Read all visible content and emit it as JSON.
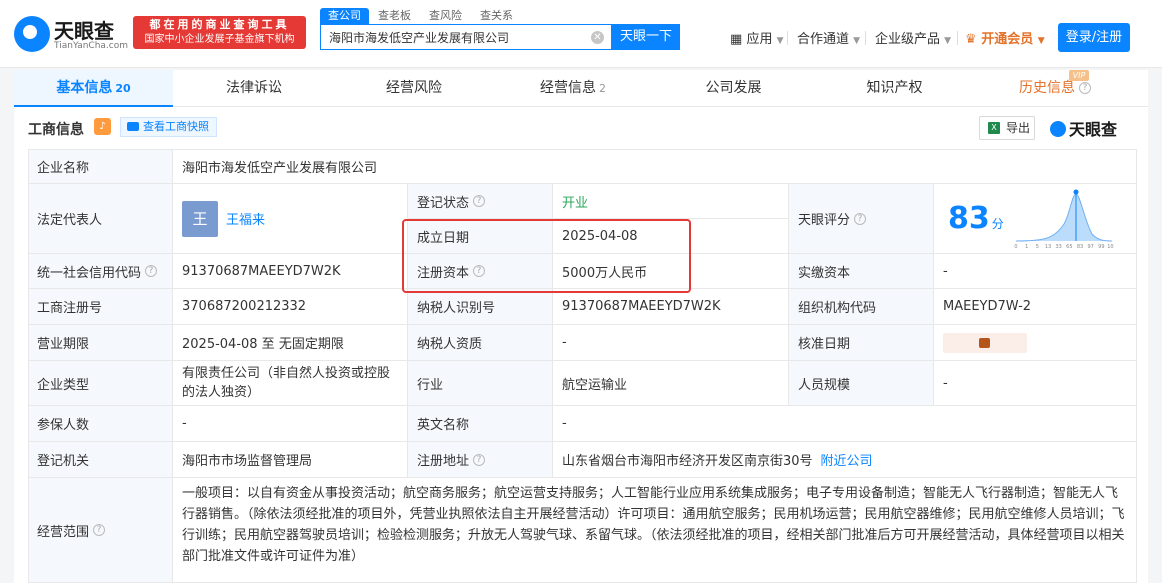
{
  "header": {
    "logo_name": "天眼查",
    "logo_sub": "TianYanCha.com",
    "banner_line1": "都在用的商业查询工具",
    "banner_line2": "国家中小企业发展子基金旗下机构",
    "search_tabs": [
      "查公司",
      "查老板",
      "查风险",
      "查关系"
    ],
    "search_value": "海阳市海发低空产业发展有限公司",
    "search_button": "天眼一下",
    "nav": {
      "apps": "应用",
      "partner": "合作通道",
      "enterprise": "企业级产品",
      "vip": "开通会员",
      "login": "登录/注册"
    }
  },
  "tabs": [
    {
      "label": "基本信息",
      "count": "20"
    },
    {
      "label": "法律诉讼",
      "count": ""
    },
    {
      "label": "经营风险",
      "count": ""
    },
    {
      "label": "经营信息",
      "count": "2"
    },
    {
      "label": "公司发展",
      "count": ""
    },
    {
      "label": "知识产权",
      "count": ""
    },
    {
      "label": "历史信息",
      "count": ""
    }
  ],
  "vip_badge": "VIP",
  "section": {
    "title": "工商信息",
    "snapshot": "查看工商快照",
    "export": "导出",
    "brand": "天眼查"
  },
  "rows": {
    "name_label": "企业名称",
    "name_value": "海阳市海发低空产业发展有限公司",
    "legal_label": "法定代表人",
    "legal_avatar": "王",
    "legal_value": "王福来",
    "status_label": "登记状态",
    "status_value": "开业",
    "rating_label": "天眼评分",
    "rating_value": "83",
    "rating_unit": "分",
    "found_label": "成立日期",
    "found_value": "2025-04-08",
    "capital_label": "注册资本",
    "capital_value": "5000万人民币",
    "paid_label": "实缴资本",
    "paid_value": "-",
    "credit_label": "统一社会信用代码",
    "credit_value": "91370687MAEEYD7W2K",
    "reg_label": "工商注册号",
    "reg_value": "370687200212332",
    "taxid_label": "纳税人识别号",
    "taxid_value": "91370687MAEEYD7W2K",
    "org_label": "组织机构代码",
    "org_value": "MAEEYD7W-2",
    "term_label": "营业期限",
    "term_value": "2025-04-08 至 无固定期限",
    "taxq_label": "纳税人资质",
    "taxq_value": "-",
    "approve_label": "核准日期",
    "type_label": "企业类型",
    "type_value": "有限责任公司（非自然人投资或控股的法人独资）",
    "industry_label": "行业",
    "industry_value": "航空运输业",
    "staff_label": "人员规模",
    "staff_value": "-",
    "insured_label": "参保人数",
    "insured_value": "-",
    "en_label": "英文名称",
    "en_value": "-",
    "authority_label": "登记机关",
    "authority_value": "海阳市市场监督管理局",
    "addr_label": "注册地址",
    "addr_value": "山东省烟台市海阳市经济开发区南京街30号",
    "nearby": "附近公司",
    "scope_label": "经营范围",
    "scope_value": "一般项目：以自有资金从事投资活动；航空商务服务；航空运营支持服务；人工智能行业应用系统集成服务；电子专用设备制造；智能无人飞行器制造；智能无人飞行器销售。（除依法须经批准的项目外，凭营业执照依法自主开展经营活动）许可项目：通用航空服务；民用机场运营；民用航空器维修；民用航空维修人员培训；飞行训练；民用航空器驾驶员培训；检验检测服务；升放无人驾驶气球、系留气球。（依法须经批准的项目，经相关部门批准后方可开展经营活动，具体经营项目以相关部门批准文件或许可证件为准）"
  },
  "score_chart_ticks": [
    "0",
    "1",
    "5",
    "13",
    "33",
    "65",
    "83",
    "97",
    "99",
    "100"
  ],
  "colors": {
    "accent": "#0a84ff",
    "highlight_box": "#e53935",
    "vip": "#e4722a"
  }
}
